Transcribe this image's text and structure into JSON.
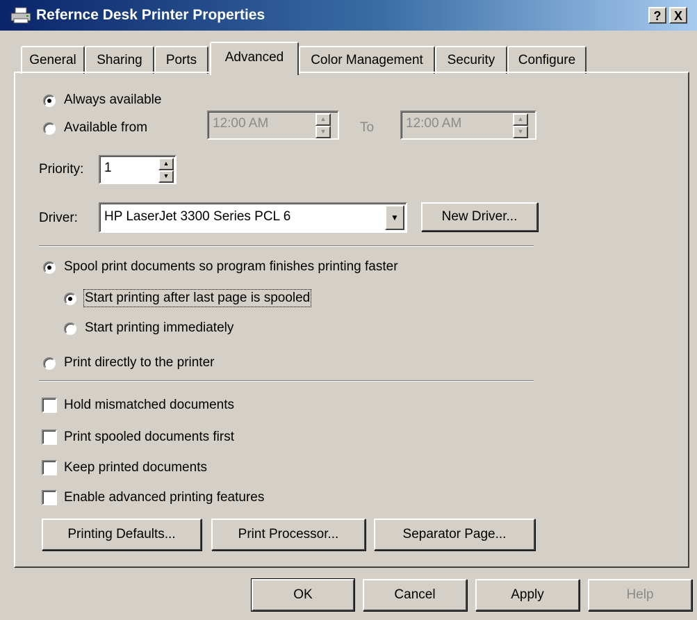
{
  "window": {
    "title": "Refernce Desk Printer Properties",
    "help_label": "?",
    "close_label": "X"
  },
  "tabs": [
    {
      "label": "General"
    },
    {
      "label": "Sharing"
    },
    {
      "label": "Ports"
    },
    {
      "label": "Advanced",
      "selected": true
    },
    {
      "label": "Color Management"
    },
    {
      "label": "Security"
    },
    {
      "label": "Configure"
    }
  ],
  "availability": {
    "always_label": "Always available",
    "from_label": "Available from",
    "selected": "always",
    "from_time": "12:00 AM",
    "to_label": "To",
    "to_time": "12:00 AM"
  },
  "priority": {
    "label": "Priority:",
    "value": "1"
  },
  "driver": {
    "label": "Driver:",
    "value": "HP LaserJet 3300 Series PCL 6",
    "new_driver_label": "New Driver..."
  },
  "spool": {
    "spool_label": "Spool print documents so program finishes printing faster",
    "after_last_label": "Start printing after last page is spooled",
    "immediately_label": "Start printing immediately",
    "direct_label": "Print directly to the printer",
    "selected": "spool",
    "spool_option": "after_last"
  },
  "options": [
    {
      "label": "Hold mismatched documents",
      "checked": false
    },
    {
      "label": "Print spooled documents first",
      "checked": false
    },
    {
      "label": "Keep printed documents",
      "checked": false
    },
    {
      "label": "Enable advanced printing features",
      "checked": false
    }
  ],
  "buttons": {
    "printing_defaults": "Printing Defaults...",
    "print_processor": "Print Processor...",
    "separator_page": "Separator Page..."
  },
  "dialog": {
    "ok": "OK",
    "cancel": "Cancel",
    "apply": "Apply",
    "help": "Help"
  },
  "colors": {
    "title_start": "#0a246a",
    "title_end": "#a6caf0",
    "face": "#d4d0c8",
    "disabled_text": "#8a8a8a"
  }
}
